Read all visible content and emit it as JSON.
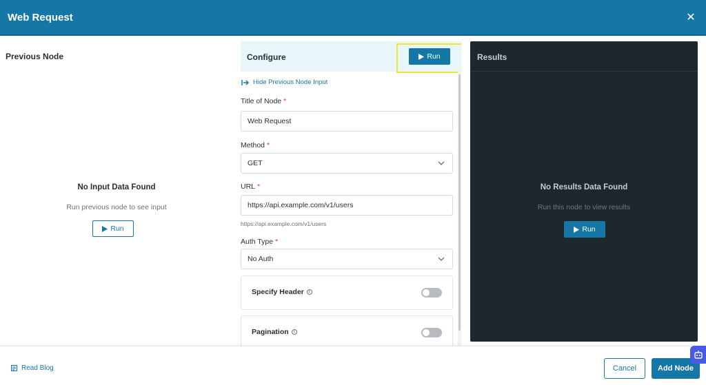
{
  "header": {
    "title": "Web Request",
    "close_label": "✕"
  },
  "previous_node": {
    "title": "Previous Node",
    "empty_title": "No Input Data Found",
    "empty_subtitle": "Run previous node to see input",
    "run_label": "Run"
  },
  "configure": {
    "title": "Configure",
    "run_label": "Run",
    "hide_link": "Hide Previous Node Input",
    "fields": {
      "title_label": "Title of Node",
      "title_value": "Web Request",
      "method_label": "Method",
      "method_value": "GET",
      "url_label": "URL",
      "url_value": "https://api.example.com/v1/users",
      "url_hint": "https://api.example.com/v1/users",
      "auth_label": "Auth Type",
      "auth_value": "No Auth",
      "required_mark": "*"
    },
    "toggles": [
      {
        "label": "Specify Header",
        "on": false
      },
      {
        "label": "Pagination",
        "on": false
      }
    ]
  },
  "results": {
    "title": "Results",
    "empty_title": "No Results Data Found",
    "empty_subtitle": "Run this node to view results",
    "run_label": "Run"
  },
  "footer": {
    "read_blog": "Read Blog",
    "cancel": "Cancel",
    "add_node": "Add Node"
  },
  "colors": {
    "primary": "#1577a5",
    "highlight": "#f0e62a",
    "results_bg": "#1e272c",
    "required": "#d63b3b"
  }
}
